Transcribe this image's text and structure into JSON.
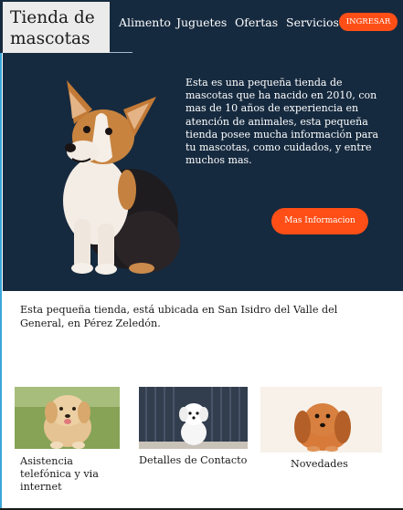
{
  "header": {
    "logo_text": "Tienda de mascotas",
    "nav": [
      "Alimento",
      "Juguetes",
      "Ofertas",
      "Servicios"
    ],
    "login_label": "INGRESAR"
  },
  "hero": {
    "description": "Esta es una pequeña tienda de mascotas que ha nacido en 2010, con mas de 10 años de experiencia en atención de animales, esta pequeña tienda posee mucha información para tu mascotas, como cuidados, y entre muchos mas.",
    "button_label": "Mas Informacion",
    "image": "corgi-dog-photo"
  },
  "location": {
    "text": "Esta pequeña tienda, está ubicada en San Isidro del Valle del General, en Pérez Zeledón."
  },
  "cards": [
    {
      "label": "Asistencia telefónica y via internet",
      "image": "golden-puppy-photo"
    },
    {
      "label": "Detalles de Contacto",
      "image": "white-puppy-photo"
    },
    {
      "label": "Novedades",
      "image": "dachshund-puppy-photo"
    }
  ],
  "colors": {
    "navy": "#162a3f",
    "accent": "#ff4f17",
    "logo_bg": "#ebebeb"
  }
}
